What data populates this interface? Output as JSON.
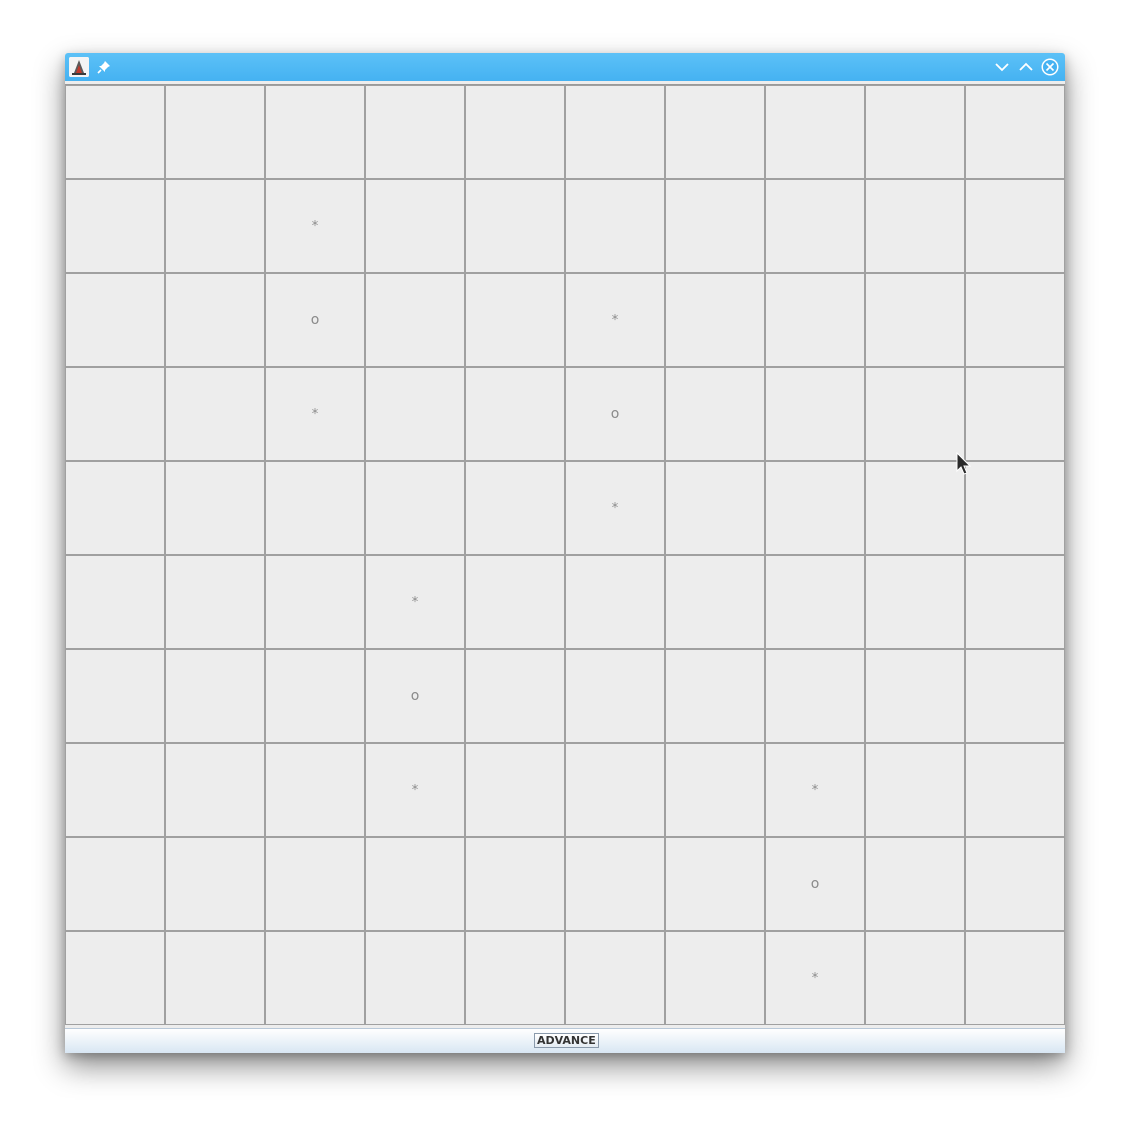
{
  "window": {
    "title": "",
    "titlebar_color": "#45b2f2",
    "icons": {
      "app": "java-app-icon",
      "pin": "pin-icon",
      "minimize": "chevron-down-icon",
      "maximize": "chevron-up-icon",
      "close": "close-icon"
    }
  },
  "board": {
    "rows": 10,
    "cols": 10,
    "cells": [
      [
        "",
        "",
        "",
        "",
        "",
        "",
        "",
        "",
        "",
        ""
      ],
      [
        "",
        "",
        "*",
        "",
        "",
        "",
        "",
        "",
        "",
        ""
      ],
      [
        "",
        "",
        "o",
        "",
        "",
        "*",
        "",
        "",
        "",
        ""
      ],
      [
        "",
        "",
        "*",
        "",
        "",
        "o",
        "",
        "",
        "",
        ""
      ],
      [
        "",
        "",
        "",
        "",
        "",
        "*",
        "",
        "",
        "",
        ""
      ],
      [
        "",
        "",
        "",
        "*",
        "",
        "",
        "",
        "",
        "",
        ""
      ],
      [
        "",
        "",
        "",
        "o",
        "",
        "",
        "",
        "",
        "",
        ""
      ],
      [
        "",
        "",
        "",
        "*",
        "",
        "",
        "",
        "*",
        "",
        ""
      ],
      [
        "",
        "",
        "",
        "",
        "",
        "",
        "",
        "o",
        "",
        ""
      ],
      [
        "",
        "",
        "",
        "",
        "",
        "",
        "",
        "*",
        "",
        ""
      ]
    ]
  },
  "controls": {
    "advance_label": "ADVANCE"
  }
}
